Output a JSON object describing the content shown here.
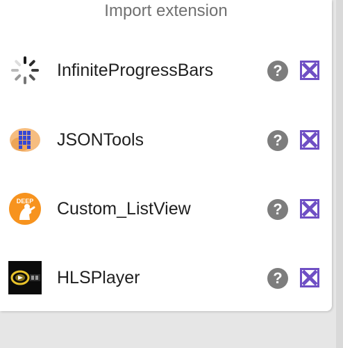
{
  "header": {
    "title": "Import extension"
  },
  "extensions": [
    {
      "name": "InfiniteProgressBars",
      "icon": "spinner-icon"
    },
    {
      "name": "JSONTools",
      "icon": "grid-blocks-icon"
    },
    {
      "name": "Custom_ListView",
      "icon": "deep-badge-icon"
    },
    {
      "name": "HLSPlayer",
      "icon": "video-player-icon"
    }
  ],
  "actions": {
    "help_label": "?",
    "delete_icon": "delete-x-icon"
  },
  "badge_text": "DEEP",
  "colors": {
    "help_button": "#7d7d7d",
    "delete_button": "#6f4fc4",
    "header_text": "#707070",
    "jsontools_blue": "#3548d6",
    "deep_orange": "#f7931e"
  }
}
